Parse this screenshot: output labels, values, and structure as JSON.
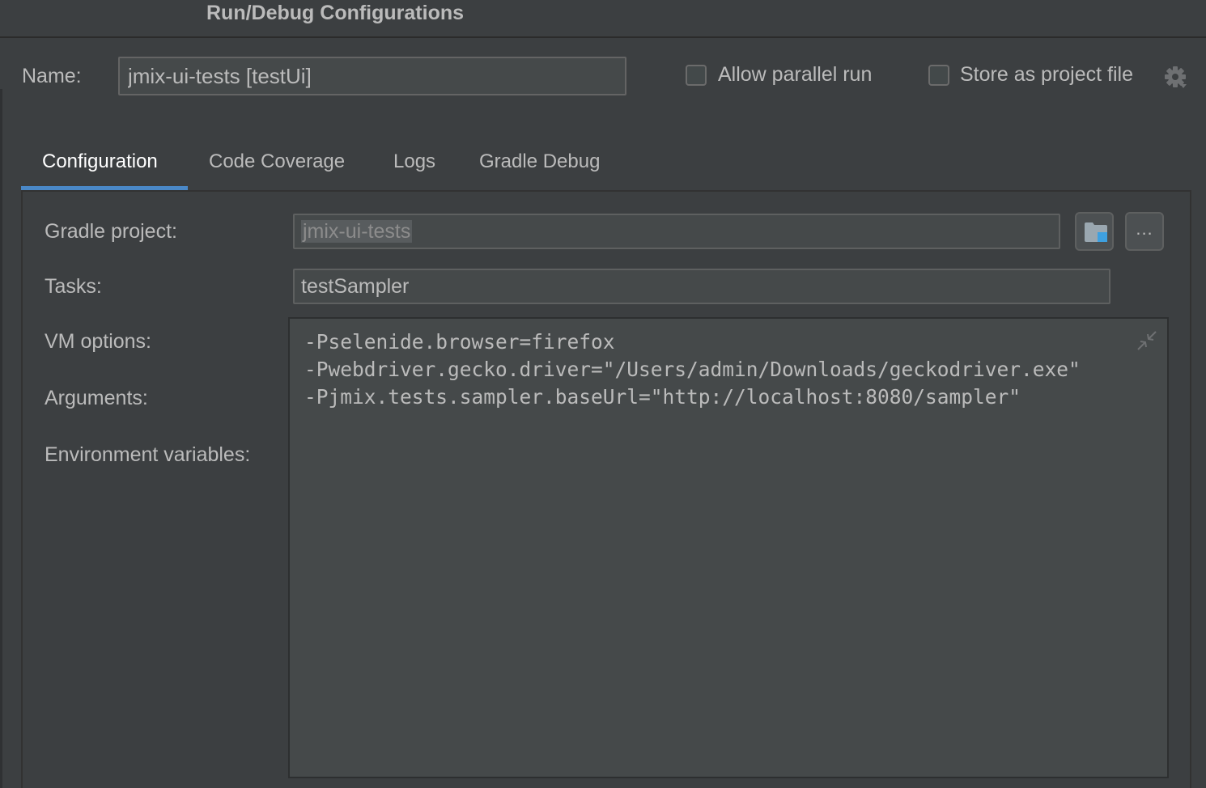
{
  "window": {
    "title": "Run/Debug Configurations"
  },
  "name_field": {
    "label": "Name:",
    "value": "jmix-ui-tests [testUi]"
  },
  "options": {
    "allow_parallel_run": {
      "label": "Allow parallel run",
      "checked": false
    },
    "store_as_project_file": {
      "label": "Store as project file",
      "checked": false
    }
  },
  "icons": {
    "settings": "gear-icon",
    "browse": "folder-icon",
    "more": "ellipsis-icon",
    "collapse": "collapse-icon"
  },
  "tabs": [
    {
      "label": "Configuration",
      "active": true
    },
    {
      "label": "Code Coverage",
      "active": false
    },
    {
      "label": "Logs",
      "active": false
    },
    {
      "label": "Gradle Debug",
      "active": false
    }
  ],
  "form": {
    "gradle_project": {
      "label": "Gradle project:",
      "value": "jmix-ui-tests"
    },
    "tasks": {
      "label": "Tasks:",
      "value": "testSampler"
    },
    "vm_options": {
      "label": "VM options:",
      "value": "-Pselenide.browser=firefox\n-Pwebdriver.gecko.driver=\"/Users/admin/Downloads/geckodriver.exe\"\n-Pjmix.tests.sampler.baseUrl=\"http://localhost:8080/sampler\""
    },
    "arguments": {
      "label": "Arguments:"
    },
    "environment_variables": {
      "label": "Environment variables:"
    },
    "more_button": "..."
  },
  "colors": {
    "background": "#3c3f41",
    "field_background": "#45494a",
    "text": "#bbbbbb",
    "accent": "#4a88c7",
    "folder_badge": "#3ea0e0"
  }
}
